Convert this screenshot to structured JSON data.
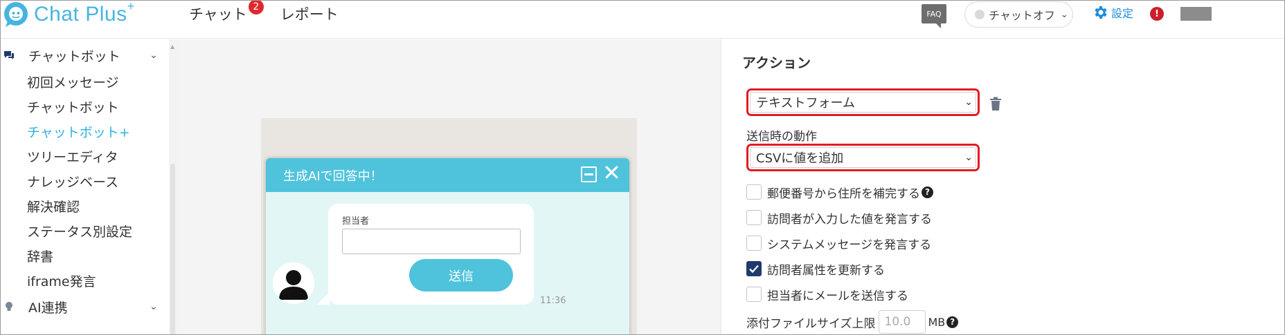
{
  "header": {
    "logo_text": "Chat Plus",
    "logo_sup": "+",
    "nav": [
      {
        "label": "チャット",
        "badge": "2"
      },
      {
        "label": "レポート"
      }
    ],
    "faq_label": "FAQ",
    "chat_status": "チャットオフ",
    "settings_label": "設定",
    "alert_label": "!"
  },
  "sidebar": {
    "sections": [
      {
        "label": "チャットボット",
        "icon": "chat-icon"
      },
      {
        "label": "AI連携",
        "icon": "lightbulb-icon"
      }
    ],
    "items": [
      {
        "label": "初回メッセージ"
      },
      {
        "label": "チャットボット"
      },
      {
        "label": "チャットボット+",
        "active": true
      },
      {
        "label": "ツリーエディタ"
      },
      {
        "label": "ナレッジベース"
      },
      {
        "label": "解決確認"
      },
      {
        "label": "ステータス別設定"
      },
      {
        "label": "辞書"
      },
      {
        "label": "iframe発言"
      }
    ]
  },
  "preview": {
    "chat_title": "生成AIで回答中！",
    "field_label": "担当者",
    "field_value": "",
    "send_label": "送信",
    "time": "11:36"
  },
  "panel": {
    "title": "アクション",
    "action_select": "テキストフォーム",
    "on_send_label": "送信時の動作",
    "on_send_select": "CSVに値を追加",
    "checkboxes": [
      {
        "label": "郵便番号から住所を補完する",
        "checked": false,
        "help": true
      },
      {
        "label": "訪問者が入力した値を発言する",
        "checked": false
      },
      {
        "label": "システムメッセージを発言する",
        "checked": false
      },
      {
        "label": "訪問者属性を更新する",
        "checked": true
      },
      {
        "label": "担当者にメールを送信する",
        "checked": false
      }
    ],
    "attachment_label": "添付ファイルサイズ上限",
    "attachment_placeholder": "10.0",
    "attachment_unit": "MB"
  },
  "colors": {
    "brand": "#47b4e0",
    "chat_header": "#4fc3dc",
    "active_nav": "#2eb3dd",
    "highlight_border": "#e31b23",
    "checkbox_checked": "#1f3a6b",
    "badge": "#e0292f"
  }
}
